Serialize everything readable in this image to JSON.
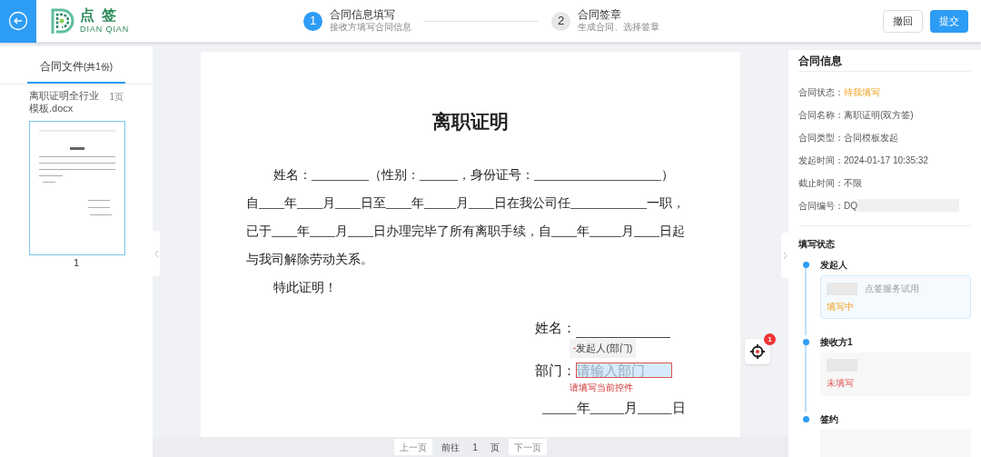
{
  "header": {
    "steps": [
      {
        "number": "1",
        "title": "合同信息填写",
        "subtitle": "接收方填写合同信息",
        "selected": true
      },
      {
        "number": "2",
        "title": "合同签章",
        "subtitle": "生成合同、选择签章",
        "selected": false
      }
    ],
    "logo": {
      "name": "点 签",
      "subname": "DIAN QIAN"
    },
    "buttons": [
      {
        "label": "撤回",
        "primary": false
      },
      {
        "label": "提交",
        "primary": true
      }
    ]
  },
  "files": {
    "tab": "合同文件",
    "count": "(共1份)",
    "items": [
      {
        "name": "离职证明全行业模板.docx",
        "pages": "1页",
        "page_number": "1",
        "selected": true
      }
    ]
  },
  "document": {
    "title": "离职证明",
    "paragraphs": [
      {
        "text": "姓名：_________（性别：______，身份证号：____________________）",
        "indent": true
      },
      {
        "text": "自____年____月____日至____年_____月____日在我公司任____________一职，",
        "indent": false
      },
      {
        "text": "已于____年____月____日办理完毕了所有离职手续，自____年_____月____日起",
        "indent": false
      },
      {
        "text": "与我司解除劳动关系。",
        "indent": false
      },
      {
        "text": "特此证明！",
        "indent": true
      }
    ],
    "sign": {
      "name_label": "姓名：",
      "field_tag_mark": "*",
      "field_tag": "发起人(部门)",
      "dept_label": "部门：",
      "dept_placeholder": "请输入部门",
      "error": "请填写当前控件",
      "date_line": "_____年_____月_____日"
    },
    "locate_badge": "1",
    "pagination": {
      "prev": "上一页",
      "goto": "前往",
      "page": "1",
      "page_unit": "页",
      "next": "下一页"
    }
  },
  "info": {
    "title": "合同信息",
    "rows": [
      {
        "label": "合同状态：",
        "value": "待我填写",
        "kind": "status"
      },
      {
        "label": "合同名称：",
        "value": "离职证明(双方签)",
        "kind": "plain"
      },
      {
        "label": "合同类型：",
        "value": "合同模板发起",
        "kind": "plain"
      },
      {
        "label": "发起时间：",
        "value": "2024-01-17 10:35:32",
        "kind": "plain"
      },
      {
        "label": "截止时间：",
        "value": "不限",
        "kind": "plain"
      },
      {
        "label": "合同编号：",
        "value": "DQ",
        "kind": "plain",
        "redacted": true
      }
    ],
    "status_title": "填写状态",
    "parties": [
      {
        "role": "发起人",
        "company": "点签服务试用",
        "status": "填写中",
        "kind": "filling",
        "active": true
      },
      {
        "role": "接收方1",
        "status": "未填写",
        "kind": "unfilled",
        "active": false
      },
      {
        "role": "签约",
        "active": false
      }
    ]
  }
}
